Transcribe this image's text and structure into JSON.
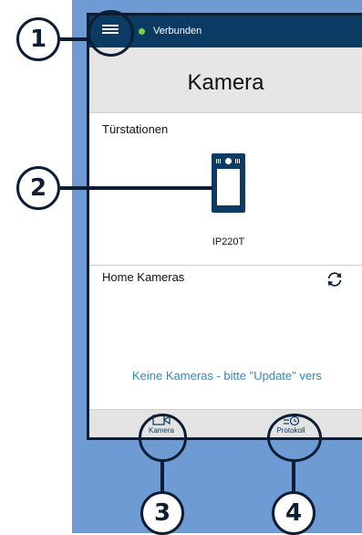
{
  "status_bar": {
    "status_text": "Verbunden",
    "status_color": "#7ed03a",
    "menu_icon": "hamburger-menu-icon"
  },
  "header": {
    "title": "Kamera"
  },
  "door_stations": {
    "section_label": "Türstationen",
    "devices": [
      {
        "name": "IP220T",
        "icon": "door-station-icon"
      }
    ]
  },
  "home_cameras": {
    "section_label": "Home Kameras",
    "refresh_icon": "refresh-icon",
    "empty_message": "Keine Kameras - bitte \"Update\" vers"
  },
  "tabbar": {
    "tabs": [
      {
        "label": "Kamera",
        "icon": "video-camera-icon"
      },
      {
        "label": "Protokoll",
        "icon": "history-log-icon"
      }
    ]
  },
  "callouts": [
    "1",
    "2",
    "3",
    "4"
  ],
  "colors": {
    "primary": "#0b3a63",
    "background_accent": "#6e9bd4",
    "link": "#2f88c8"
  }
}
